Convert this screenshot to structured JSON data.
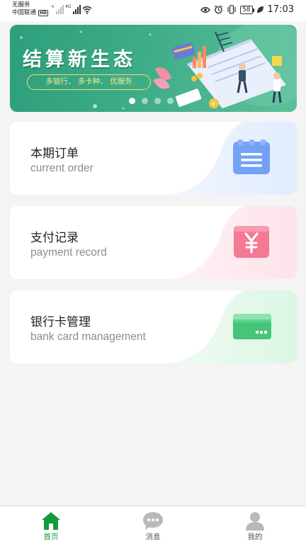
{
  "status_bar": {
    "carrier_line1": "无服务",
    "carrier_line2": "中国联通",
    "hd": "HD",
    "signal_tag1": "×",
    "signal_tag2": "4G",
    "battery": "58",
    "time": "17:03"
  },
  "banner": {
    "title": "结算新生态",
    "tagline": "多银行、  多卡种、  优服务",
    "slide_count": 4,
    "active_slide": 0
  },
  "cards": [
    {
      "title": "本期订单",
      "subtitle": "current order",
      "icon": "document-list-icon",
      "accent": "#5b8ff2"
    },
    {
      "title": "支付记录",
      "subtitle": "payment record",
      "icon": "yuan-receipt-icon",
      "accent": "#f57a93"
    },
    {
      "title": "银行卡管理",
      "subtitle": "bank card management",
      "icon": "bank-card-icon",
      "accent": "#46c77b"
    }
  ],
  "bottom_nav": [
    {
      "label": "首页",
      "icon": "home-icon",
      "active": true
    },
    {
      "label": "消息",
      "icon": "message-icon",
      "active": false
    },
    {
      "label": "我的",
      "icon": "profile-icon",
      "active": false
    }
  ],
  "colors": {
    "brand_green": "#129b3b",
    "banner_green": "#3eac87",
    "background": "#f4f4f4"
  }
}
